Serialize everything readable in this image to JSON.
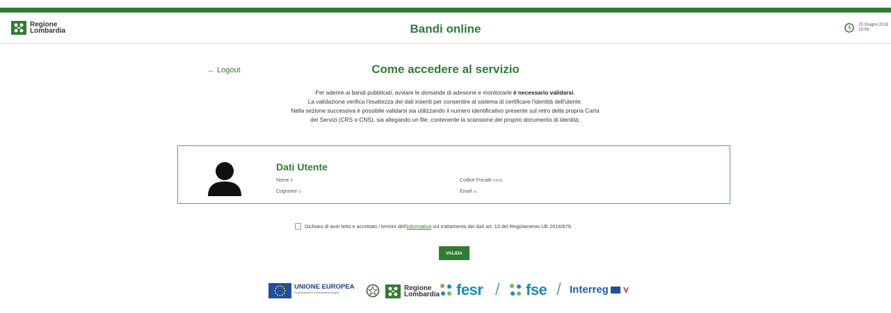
{
  "header": {
    "logo_line1": "Regione",
    "logo_line2": "Lombardia",
    "title": "Bandi online",
    "date": "25 Giugno 2019",
    "time": "10:59"
  },
  "nav": {
    "logout": "← Logout"
  },
  "page": {
    "title": "Come accedere al servizio",
    "intro_line1_a": "Per aderire ai bandi pubblicati, avviare le domande di adesione e monitorarle ",
    "intro_line1_b": "è necessario validarsi",
    "intro_line1_c": ".",
    "intro_line2": "La validazione verifica l'esattezza dei dati inseriti per consentire al sistema di certificare l'identità dell'utente.",
    "intro_line3": "Nella sezione successiva è possibile validarsi sia utilizzando il numero identificativo presente sul retro della propria Carta",
    "intro_line4": "dei Servizi (CRS o CNS), sia allegando un file, contenente la scansione del proprio documento di identità;"
  },
  "user_card": {
    "title": "Dati Utente",
    "nome_label": "Nome",
    "nome_value": "B",
    "cognome_label": "Cognome",
    "cognome_value": "G",
    "cf_label": "Codice Fiscale",
    "cf_value": "GNSE",
    "email_label": "Email",
    "email_value": "sc"
  },
  "consent": {
    "text_before": "Dichiaro di aver letto e accettato i termini dell'",
    "link": "informativa",
    "text_after": " sul trattamento dei dati art. 13 del Regolamento UE 2016/679."
  },
  "button": {
    "valida": "VALIDA"
  },
  "footer": {
    "eu_title": "UNIONE EUROPEA",
    "eu_sub": "Fondi strutturali e di investimento europei",
    "rl_line1": "Regione",
    "rl_line2": "Lombardia",
    "fesr": "fesr",
    "fse": "fse",
    "slash": "/",
    "interreg": "Interreg"
  },
  "colors": {
    "primary": "#2e7d32",
    "eu_blue": "#1f4fa3",
    "fesr_blue": "#1d8ab8"
  }
}
